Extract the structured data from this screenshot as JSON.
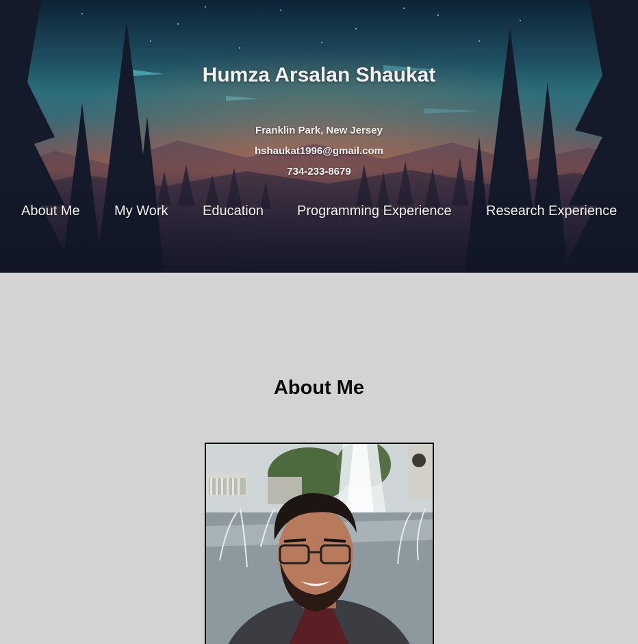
{
  "header": {
    "title": "Humza Arsalan Shaukat",
    "location": "Franklin Park, New Jersey",
    "email": "hshaukat1996@gmail.com",
    "phone": "734-233-8679"
  },
  "nav": {
    "items": [
      {
        "label": "About Me"
      },
      {
        "label": "My Work"
      },
      {
        "label": "Education"
      },
      {
        "label": "Programming Experience"
      },
      {
        "label": "Research Experience"
      }
    ]
  },
  "main": {
    "section_title": "About Me",
    "photo_icon": "profile-photo"
  },
  "colors": {
    "page_background": "#d3d3d3",
    "header_text": "#f2f2f2",
    "heading_text": "#0a0a0a"
  }
}
